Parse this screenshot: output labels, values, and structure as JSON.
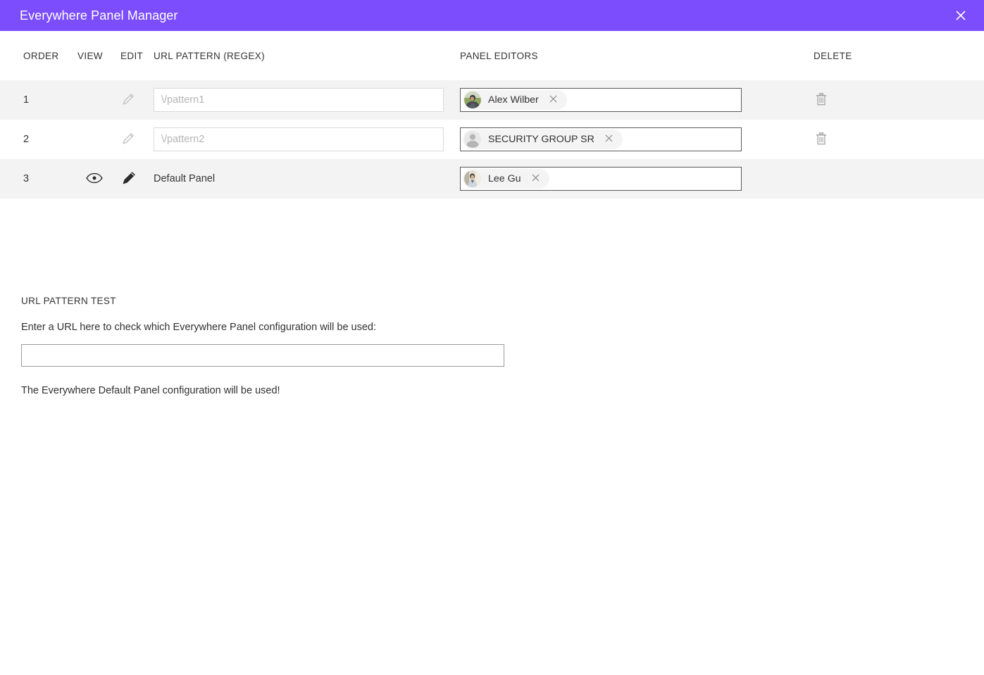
{
  "window": {
    "title": "Everywhere Panel Manager",
    "close_label": "close-icon",
    "accent_color": "#7b4dfd",
    "row_shade_color": "#f3f3f3"
  },
  "table": {
    "columns": [
      {
        "key": "order",
        "label": "ORDER"
      },
      {
        "key": "view",
        "label": "VIEW"
      },
      {
        "key": "edit",
        "label": "EDIT"
      },
      {
        "key": "url",
        "label": "URL PATTERN (REGEX)"
      },
      {
        "key": "editors",
        "label": "PANEL EDITORS"
      },
      {
        "key": "delete",
        "label": "DELETE"
      }
    ],
    "rows": [
      {
        "order": "1",
        "view_icon": "",
        "edit_icon": "pencil-icon",
        "edit_enabled": false,
        "url_value": "",
        "url_placeholder": "\\/pattern1",
        "url_is_input": true,
        "editor": {
          "name": "Alex Wilber",
          "avatar": "photo-green",
          "remove_label": "×"
        },
        "has_delete": true,
        "delete_icon": "trash-icon"
      },
      {
        "order": "2",
        "view_icon": "",
        "edit_icon": "pencil-icon",
        "edit_enabled": false,
        "url_value": "",
        "url_placeholder": "\\/pattern2",
        "url_is_input": true,
        "editor": {
          "name": "SECURITY GROUP SR",
          "avatar": "person-silhouette",
          "remove_label": "×"
        },
        "has_delete": true,
        "delete_icon": "trash-icon"
      },
      {
        "order": "3",
        "view_icon": "eye-icon",
        "edit_icon": "pencil-icon",
        "edit_enabled": true,
        "url_value": "Default Panel",
        "url_placeholder": "",
        "url_is_input": false,
        "editor": {
          "name": "Lee Gu",
          "avatar": "photo-beige",
          "remove_label": "×"
        },
        "has_delete": false,
        "delete_icon": ""
      }
    ]
  },
  "url_pattern_test": {
    "heading": "URL PATTERN TEST",
    "description": "Enter a URL here to check which Everywhere Panel configuration will be used:",
    "input_value": "",
    "input_placeholder": "",
    "result": "The Everywhere Default Panel configuration will be used!"
  }
}
